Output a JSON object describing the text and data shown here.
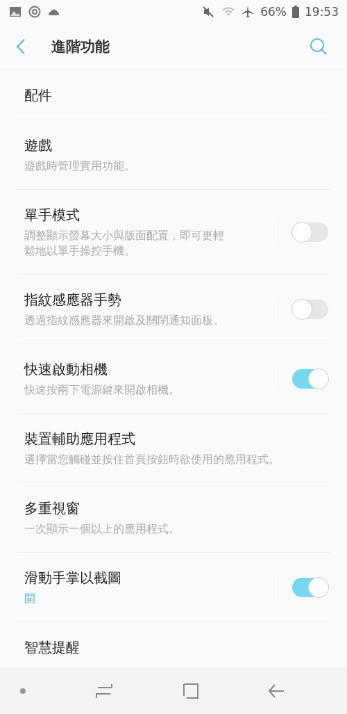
{
  "status_bar": {
    "battery": "66%",
    "time": "19:53"
  },
  "header": {
    "title": "進階功能"
  },
  "items": [
    {
      "kind": "plain",
      "title": "配件"
    },
    {
      "kind": "plain",
      "title": "遊戲",
      "summary": "遊戲時管理實用功能。",
      "accent": false
    },
    {
      "kind": "toggle",
      "title": "單手模式",
      "summary": "調整顯示螢幕大小與版面配置，即可更輕鬆地以單手操控手機。",
      "accent": false,
      "on": false
    },
    {
      "kind": "toggle",
      "title": "指紋感應器手勢",
      "summary": "透過指紋感應器來開啟及關閉通知面板。",
      "accent": false,
      "on": false
    },
    {
      "kind": "toggle",
      "title": "快速啟動相機",
      "summary": "快速按兩下電源鍵來開啟相機。",
      "accent": false,
      "on": true
    },
    {
      "kind": "plain",
      "title": "裝置輔助應用程式",
      "summary": "選擇當您觸碰並按住首頁按鈕時欲使用的應用程式。",
      "accent": false
    },
    {
      "kind": "plain",
      "title": "多重視窗",
      "summary": "一次顯示一個以上的應用程式。",
      "accent": false
    },
    {
      "kind": "toggle",
      "title": "滑動手掌以截圖",
      "summary": "開",
      "accent": true,
      "on": true
    },
    {
      "kind": "plain",
      "title": "智慧提醒"
    }
  ]
}
